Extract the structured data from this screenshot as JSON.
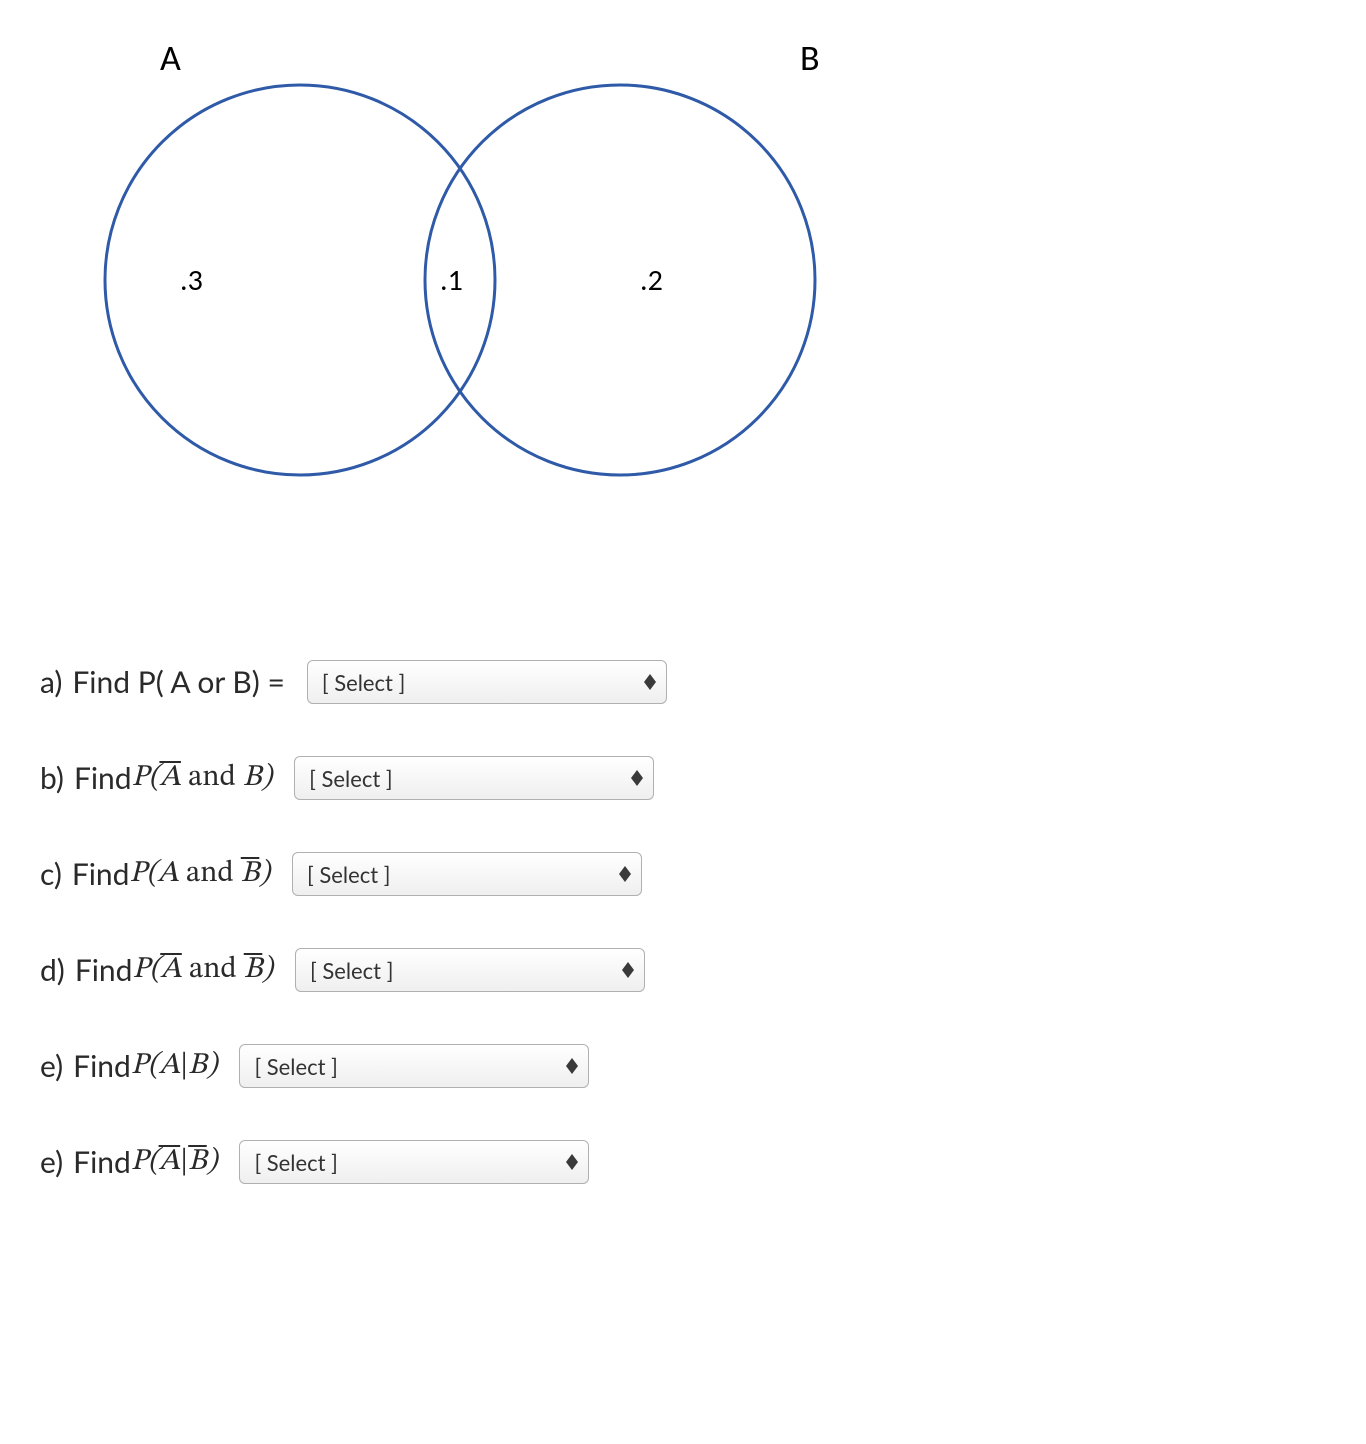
{
  "venn": {
    "labelA": "A",
    "labelB": "B",
    "valLeft": ".3",
    "valMid": ".1",
    "valRight": ".2"
  },
  "select_placeholder": "[ Select ]",
  "questions": {
    "a": {
      "bullet": "a)",
      "prefix": "Find P( A or B) ="
    },
    "b": {
      "bullet": "b)",
      "prefix": "Find "
    },
    "c": {
      "bullet": "c)",
      "prefix": "Find "
    },
    "d": {
      "bullet": "d)",
      "prefix": "Find "
    },
    "e": {
      "bullet": "e)",
      "prefix": "Find "
    },
    "f": {
      "bullet": "e)",
      "prefix": "Find "
    }
  },
  "math": {
    "b_expr_pre": "P(",
    "b_expr_A": "A",
    "b_expr_and": " and ",
    "b_expr_B": "B",
    "b_expr_post": ")",
    "given": "|"
  }
}
